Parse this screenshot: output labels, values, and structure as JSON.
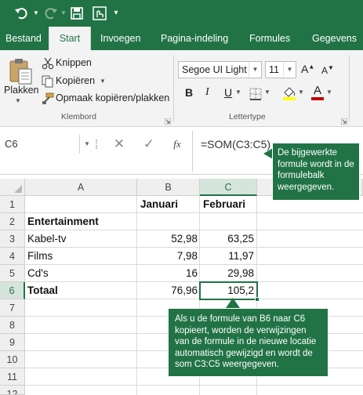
{
  "ribbon_tabs": [
    "Bestand",
    "Start",
    "Invoegen",
    "Pagina-indeling",
    "Formules",
    "Gegevens"
  ],
  "clipboard": {
    "paste_label": "Plakken",
    "cut_label": "Knippen",
    "copy_label": "Kopiëren",
    "format_painter_label": "Opmaak kopiëren/plakken",
    "group_label": "Klembord"
  },
  "font": {
    "name": "Segoe UI Light",
    "size": "11",
    "group_label": "Lettertype",
    "bold": "B",
    "italic": "I",
    "underline": "U"
  },
  "formula_bar": {
    "name_box": "C6",
    "fx": "fx",
    "formula": "=SOM(C3:C5)"
  },
  "columns": [
    "A",
    "B",
    "C"
  ],
  "rows": [
    "1",
    "2",
    "3",
    "4",
    "5",
    "6",
    "7",
    "8",
    "9",
    "10",
    "11",
    "12"
  ],
  "cells": {
    "B1": "Januari",
    "C1": "Februari",
    "A2": "Entertainment",
    "A3": "Kabel-tv",
    "B3": "52,98",
    "C3": "63,25",
    "A4": "Films",
    "B4": "7,98",
    "C4": "11,97",
    "A5": "Cd's",
    "B5": "16",
    "C5": "29,98",
    "A6": "Totaal",
    "B6": "76,96",
    "C6": "105,2"
  },
  "callouts": {
    "formula_note": "De bijgewerkte formule wordt in de formulebalk weergegeven.",
    "copy_note": "Als u de formule van B6 naar C6 kopieert, worden de verwijzingen van de formule in de nieuwe locatie automatisch gewijzigd en wordt de som C3:C5 weergegeven."
  },
  "colors": {
    "excel_green": "#217346",
    "font_color": "#c00000",
    "highlight": "#ffff00"
  }
}
